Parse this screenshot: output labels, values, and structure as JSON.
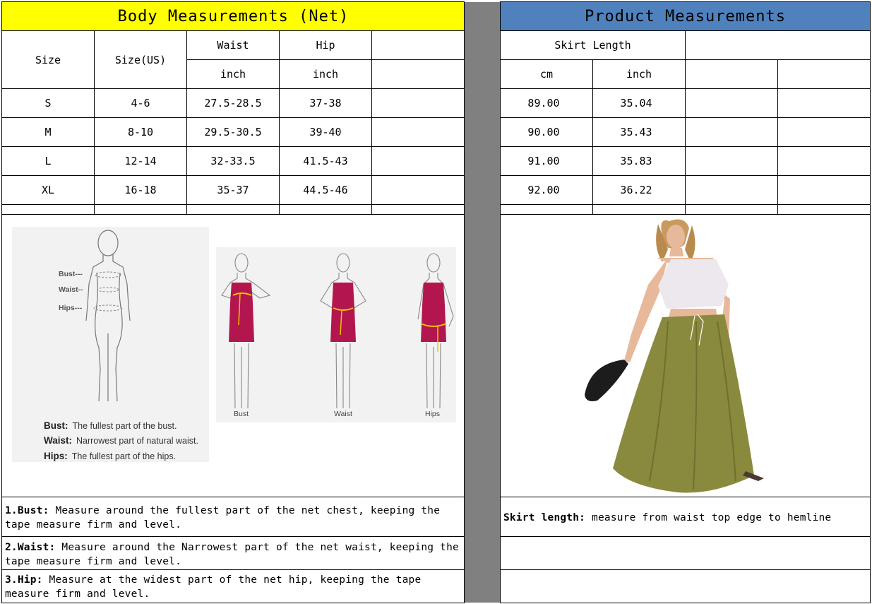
{
  "left_panel": {
    "title": "Body Measurements (Net)",
    "header": {
      "size": "Size",
      "size_us": "Size(US)",
      "waist": "Waist",
      "hip": "Hip",
      "waist_unit": "inch",
      "hip_unit": "inch"
    },
    "rows": [
      {
        "size": "S",
        "us": "4-6",
        "waist": "27.5-28.5",
        "hip": "37-38"
      },
      {
        "size": "M",
        "us": "8-10",
        "waist": "29.5-30.5",
        "hip": "39-40"
      },
      {
        "size": "L",
        "us": "12-14",
        "waist": "32-33.5",
        "hip": "41.5-43"
      },
      {
        "size": "XL",
        "us": "16-18",
        "waist": "35-37",
        "hip": "44.5-46"
      }
    ],
    "guide": {
      "body_labels": {
        "bust": "Bust---",
        "waist": "Waist--",
        "hips": "Hips---"
      },
      "legend": [
        {
          "term": "Bust:",
          "desc": "The fullest part of the bust."
        },
        {
          "term": "Waist:",
          "desc": "Narrowest part of natural waist."
        },
        {
          "term": "Hips:",
          "desc": "The fullest part of the hips."
        }
      ],
      "figure_labels": {
        "bust": "Bust",
        "waist": "Waist",
        "hips": "Hips"
      }
    },
    "notes": [
      {
        "term": "1.Bust:",
        "text": "  Measure around the fullest part of the net chest, keeping the tape  measure firm and level."
      },
      {
        "term": "2.Waist:",
        "text": " Measure around the Narrowest part of the net waist, keeping the tape  measure firm and level."
      },
      {
        "term": "3.Hip:",
        "text": " Measure at the widest part of the net hip, keeping the tape measure firm and level."
      }
    ]
  },
  "right_panel": {
    "title": "Product Measurements",
    "header": {
      "skirt_length": "Skirt Length",
      "unit_cm": "cm",
      "unit_inch": "inch"
    },
    "rows": [
      {
        "cm": "89.00",
        "inch": "35.04"
      },
      {
        "cm": "90.00",
        "inch": "35.43"
      },
      {
        "cm": "91.00",
        "inch": "35.83"
      },
      {
        "cm": "92.00",
        "inch": "36.22"
      }
    ],
    "note": {
      "term": "Skirt length:",
      "text": " measure from waist top edge to hemline"
    }
  },
  "colors": {
    "left_title_bg": "#ffff00",
    "right_title_bg": "#4f81bd",
    "divider": "#808080",
    "dress": "#b3164e",
    "tape": "#f2c200",
    "skirt": "#8a8a3e"
  }
}
